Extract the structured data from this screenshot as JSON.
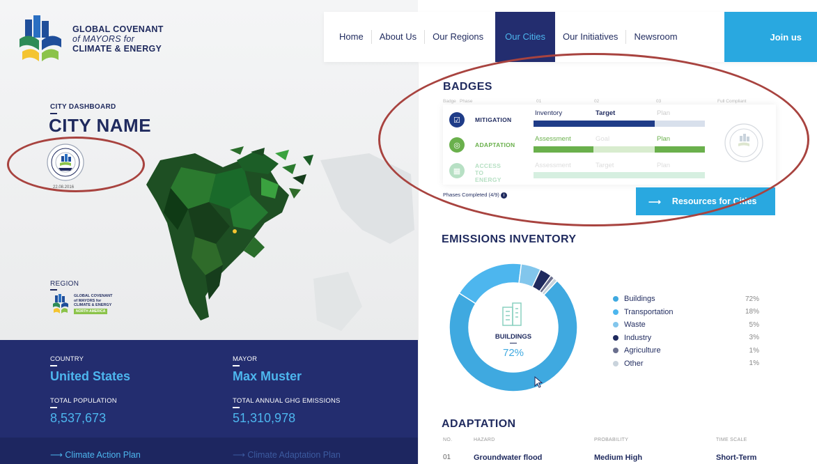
{
  "logo": {
    "line1": "GLOBAL COVENANT",
    "line2": "of MAYORS for",
    "line3": "CLIMATE & ENERGY"
  },
  "nav": {
    "items": [
      "Home",
      "About Us",
      "Our Regions",
      "Our Cities",
      "Our Initiatives",
      "Newsroom"
    ],
    "active": "Our Cities",
    "join": "Join us"
  },
  "dashboard": {
    "label": "CITY DASHBOARD",
    "city_name": "CITY NAME",
    "seal_date": "22.08.2016"
  },
  "region": {
    "label": "REGION",
    "logo_lines": [
      "GLOBAL COVENANT",
      "of MAYORS for",
      "CLIMATE & ENERGY"
    ],
    "tag": "NORTH AMERICA"
  },
  "stats": {
    "country_label": "COUNTRY",
    "country": "United States",
    "mayor_label": "MAYOR",
    "mayor": "Max Muster",
    "population_label": "TOTAL POPULATION",
    "population": "8,537,673",
    "emissions_label": "TOTAL ANNUAL GHG EMISSIONS",
    "emissions": "51,310,978"
  },
  "links": {
    "climate_action": "Climate Action Plan",
    "climate_adaptation": "Climate Adaptation Plan"
  },
  "badges": {
    "title": "BADGES",
    "header": {
      "badge": "Badge",
      "phase": "Phase",
      "p1": "01",
      "p2": "02",
      "p3": "03",
      "full": "Full Compliant"
    },
    "rows": [
      {
        "name": "MITIGATION",
        "phase1": "Inventory",
        "phase2": "Target",
        "phase3": "Plan",
        "color": "#1f3c88"
      },
      {
        "name": "ADAPTATION",
        "phase1": "Assessment",
        "phase2": "Goal",
        "phase3": "Plan",
        "color": "#6ab04c"
      },
      {
        "name_line1": "ACCESS",
        "name_line2": "TO ENERGY",
        "phase1": "Assessment",
        "phase2": "Target",
        "phase3": "Plan",
        "color": "#b7e0c4"
      }
    ],
    "phases_completed": "Phases Completed (4/9)",
    "resources_button": "Resources for Cities"
  },
  "emissions": {
    "title": "EMISSIONS INVENTORY",
    "center_label": "BUILDINGS",
    "center_value": "72%",
    "legend": [
      {
        "name": "Buildings",
        "pct": "72%",
        "color": "#3fa9e0"
      },
      {
        "name": "Transportation",
        "pct": "18%",
        "color": "#4db6ee"
      },
      {
        "name": "Waste",
        "pct": "5%",
        "color": "#82c6ec"
      },
      {
        "name": "Industry",
        "pct": "3%",
        "color": "#1f2a5e"
      },
      {
        "name": "Agriculture",
        "pct": "1%",
        "color": "#6a6f8e"
      },
      {
        "name": "Other",
        "pct": "1%",
        "color": "#c9d3dc"
      }
    ]
  },
  "adaptation": {
    "title": "ADAPTATION",
    "headers": {
      "no": "NO.",
      "hazard": "HAZARD",
      "probability": "PROBABILITY",
      "time_scale": "TIME SCALE"
    },
    "rows": [
      {
        "no": "01",
        "hazard": "Groundwater flood",
        "probability": "Medium High",
        "time_scale": "Short-Term"
      }
    ]
  }
}
